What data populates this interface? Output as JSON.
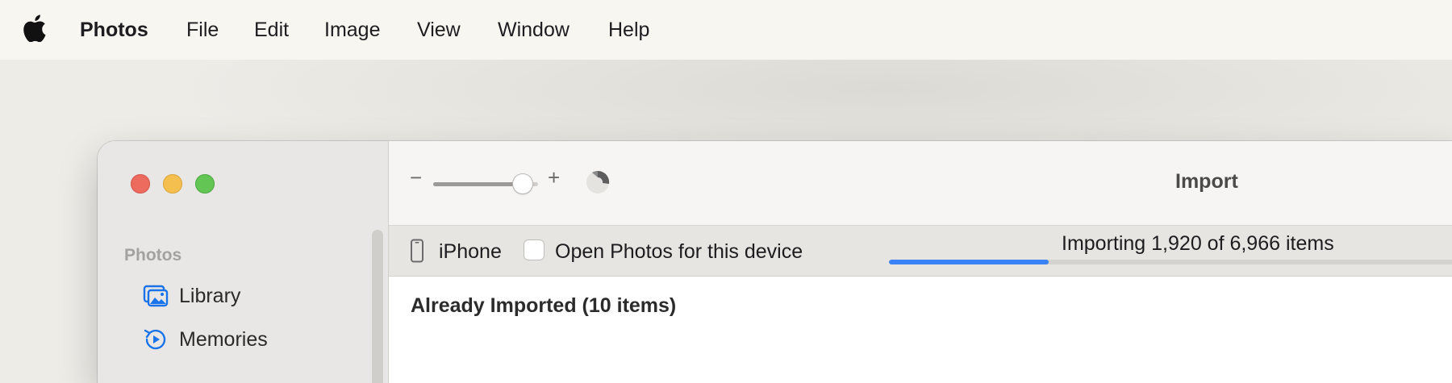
{
  "menubar": {
    "app_name": "Photos",
    "items": [
      "File",
      "Edit",
      "Image",
      "View",
      "Window",
      "Help"
    ]
  },
  "sidebar": {
    "section_label": "Photos",
    "items": [
      {
        "label": "Library",
        "icon": "library-icon"
      },
      {
        "label": "Memories",
        "icon": "memories-icon"
      }
    ]
  },
  "toolbar": {
    "zoom_minus": "−",
    "zoom_plus": "+",
    "title": "Import",
    "zoom_level": 0.85
  },
  "devicebar": {
    "device_name": "iPhone",
    "open_photos_label": "Open Photos for this device",
    "open_photos_checked": false,
    "progress_text": "Importing 1,920 of 6,966 items",
    "progress_fraction": 0.276
  },
  "content": {
    "heading": "Already Imported (10 items)"
  },
  "colors": {
    "accent": "#3b82f6",
    "traffic_red": "#ed6a5e",
    "traffic_yellow": "#f5bf4f",
    "traffic_green": "#62c554",
    "sidebar_icon": "#1a73e8"
  }
}
